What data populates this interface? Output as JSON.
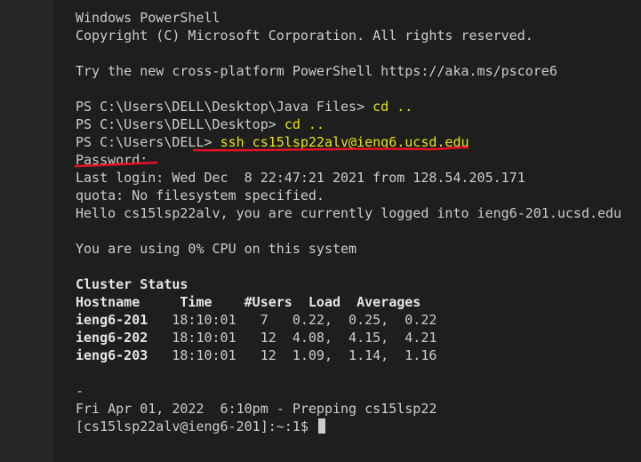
{
  "terminal": {
    "header": {
      "title": "Windows PowerShell",
      "copyright": "Copyright (C) Microsoft Corporation. All rights reserved."
    },
    "tip": "Try the new cross-platform PowerShell https://aka.ms/pscore6",
    "history": [
      {
        "prompt": "PS C:\\Users\\DELL\\Desktop\\Java Files> ",
        "command": "cd .."
      },
      {
        "prompt": "PS C:\\Users\\DELL\\Desktop> ",
        "command": "cd .."
      },
      {
        "prompt": "PS C:\\Users\\DELL> ",
        "command": "ssh cs15lsp22alv@ieng6.ucsd.edu"
      }
    ],
    "password_prompt": "Password:",
    "last_login": "Last login: Wed Dec  8 22:47:21 2021 from 128.54.205.171",
    "quota": "quota: No filesystem specified.",
    "hello": "Hello cs15lsp22alv, you are currently logged into ieng6-201.ucsd.edu",
    "cpu": "You are using 0% CPU on this system",
    "cluster": {
      "title": "Cluster Status",
      "header": "Hostname     Time    #Users  Load  Averages",
      "rows": [
        {
          "host": "ieng6-201",
          "rest": "   18:10:01   7   0.22,  0.25,  0.22"
        },
        {
          "host": "ieng6-202",
          "rest": "   18:10:01   12  4.08,  4.15,  4.21"
        },
        {
          "host": "ieng6-203",
          "rest": "   18:10:01   12  1.09,  1.14,  1.16"
        }
      ]
    },
    "dash": "-",
    "date_line": "Fri Apr 01, 2022  6:10pm - Prepping cs15lsp22",
    "shell_prompt": "[cs15lsp22alv@ieng6-201]:~:1$ ",
    "colors": {
      "background": "#1e1e1e",
      "text": "#cccccc",
      "command": "#e5e510",
      "annotation": "#e81123"
    }
  }
}
